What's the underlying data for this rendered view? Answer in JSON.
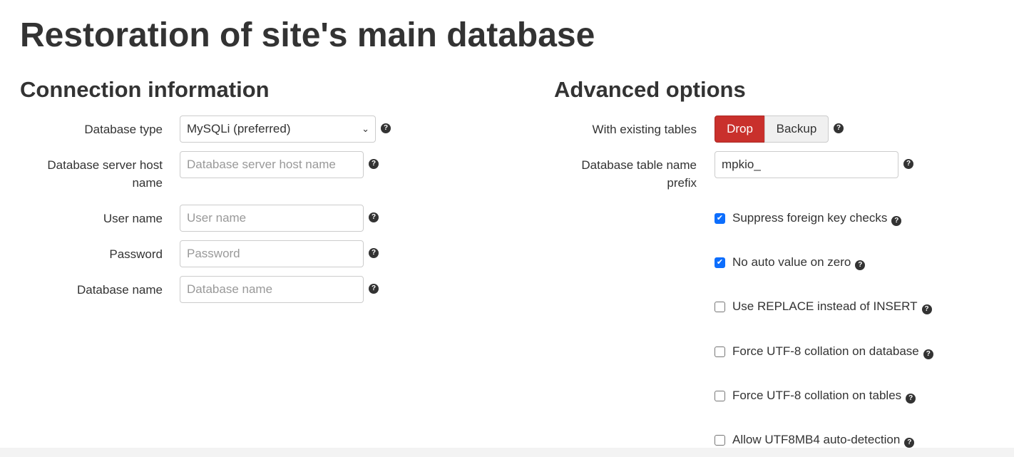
{
  "page_title": "Restoration of site's main database",
  "connection": {
    "heading": "Connection information",
    "db_type": {
      "label": "Database type",
      "value": "MySQLi (preferred)"
    },
    "host": {
      "label_line1": "Database server host",
      "label_line2": "name",
      "placeholder": "Database server host name"
    },
    "user": {
      "label": "User name",
      "placeholder": "User name"
    },
    "password": {
      "label": "Password",
      "placeholder": "Password"
    },
    "db_name": {
      "label": "Database name",
      "placeholder": "Database name"
    }
  },
  "advanced": {
    "heading": "Advanced options",
    "existing_tables": {
      "label": "With existing tables",
      "options": [
        "Drop",
        "Backup"
      ],
      "selected": "Drop",
      "accent": "#c9302c"
    },
    "prefix": {
      "label_line1": "Database table name",
      "label_line2": "prefix",
      "value": "mpkio_"
    },
    "checkboxes": [
      {
        "label": "Suppress foreign key checks",
        "checked": true
      },
      {
        "label": "No auto value on zero",
        "checked": true
      },
      {
        "label": "Use REPLACE instead of INSERT",
        "checked": false
      },
      {
        "label": "Force UTF-8 collation on database",
        "checked": false
      },
      {
        "label": "Force UTF-8 collation on tables",
        "checked": false
      },
      {
        "label": "Allow UTF8MB4 auto-detection",
        "checked": false
      }
    ]
  },
  "icons": {
    "help": "question-circle-icon",
    "chevron": "chevron-down-icon",
    "check": "check-icon"
  }
}
